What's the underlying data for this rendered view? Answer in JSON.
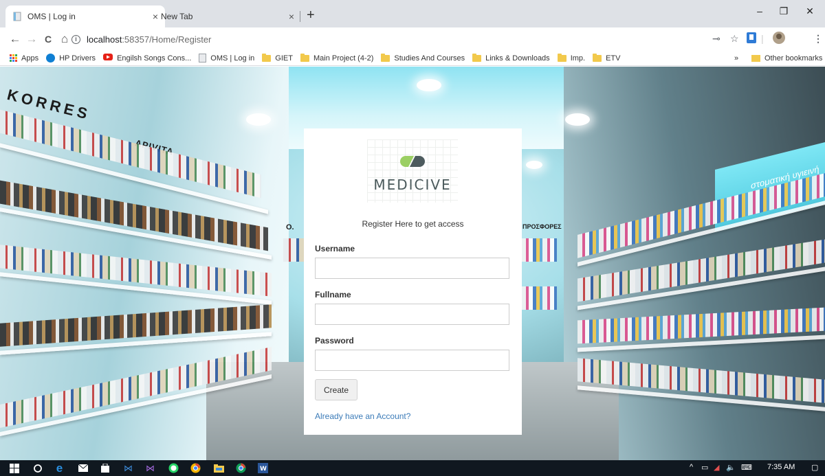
{
  "browser": {
    "tabs": [
      {
        "title": "OMS | Log in",
        "active": true
      },
      {
        "title": "New Tab",
        "active": false
      }
    ],
    "new_tab_symbol": "+",
    "close_symbol": "×",
    "window_controls": {
      "minimize": "–",
      "maximize": "❐",
      "close": "✕"
    },
    "url": {
      "host": "localhost",
      "rest": ":58357/Home/Register"
    },
    "nav": {
      "back": "←",
      "forward": "→",
      "reload": "C",
      "home": "⌂"
    }
  },
  "bookmarks": {
    "items": [
      {
        "label": "Apps",
        "icon": "apps-grid-icon"
      },
      {
        "label": "HP Drivers",
        "icon": "hp-logo-icon"
      },
      {
        "label": "Engilsh Songs Cons...",
        "icon": "youtube-icon"
      },
      {
        "label": "OMS | Log in",
        "icon": "page-icon"
      },
      {
        "label": "GIET",
        "icon": "folder-icon"
      },
      {
        "label": "Main Project (4-2)",
        "icon": "folder-icon"
      },
      {
        "label": "Studies And Courses",
        "icon": "folder-icon"
      },
      {
        "label": "Links & Downloads",
        "icon": "folder-icon"
      },
      {
        "label": "Imp.",
        "icon": "folder-icon"
      },
      {
        "label": "ETV",
        "icon": "folder-icon"
      }
    ],
    "overflow": "»",
    "other": "Other bookmarks"
  },
  "scene": {
    "left_brand": "KORRES",
    "left_brand_2": "APIVITA",
    "right_sign": "στοματική υγιεινή",
    "center_sign_left": "Ο.",
    "center_sign_right": "ΠΡΟΣΦΟΡΕΣ"
  },
  "register": {
    "logo_text": "MEDICIVE",
    "subtitle": "Register Here to get access",
    "username_label": "Username",
    "username_value": "",
    "fullname_label": "Fullname",
    "fullname_value": "",
    "password_label": "Password",
    "password_value": "",
    "create_label": "Create",
    "login_link": "Already have an Account?"
  },
  "taskbar": {
    "time": "7:35 AM",
    "apps": [
      "windows-start-icon",
      "search-icon",
      "edge-icon",
      "mail-icon",
      "store-icon",
      "visual-studio-icon",
      "visual-studio-icon",
      "whatsapp-icon",
      "chrome-icon",
      "file-explorer-icon",
      "chrome-icon",
      "word-icon"
    ]
  }
}
